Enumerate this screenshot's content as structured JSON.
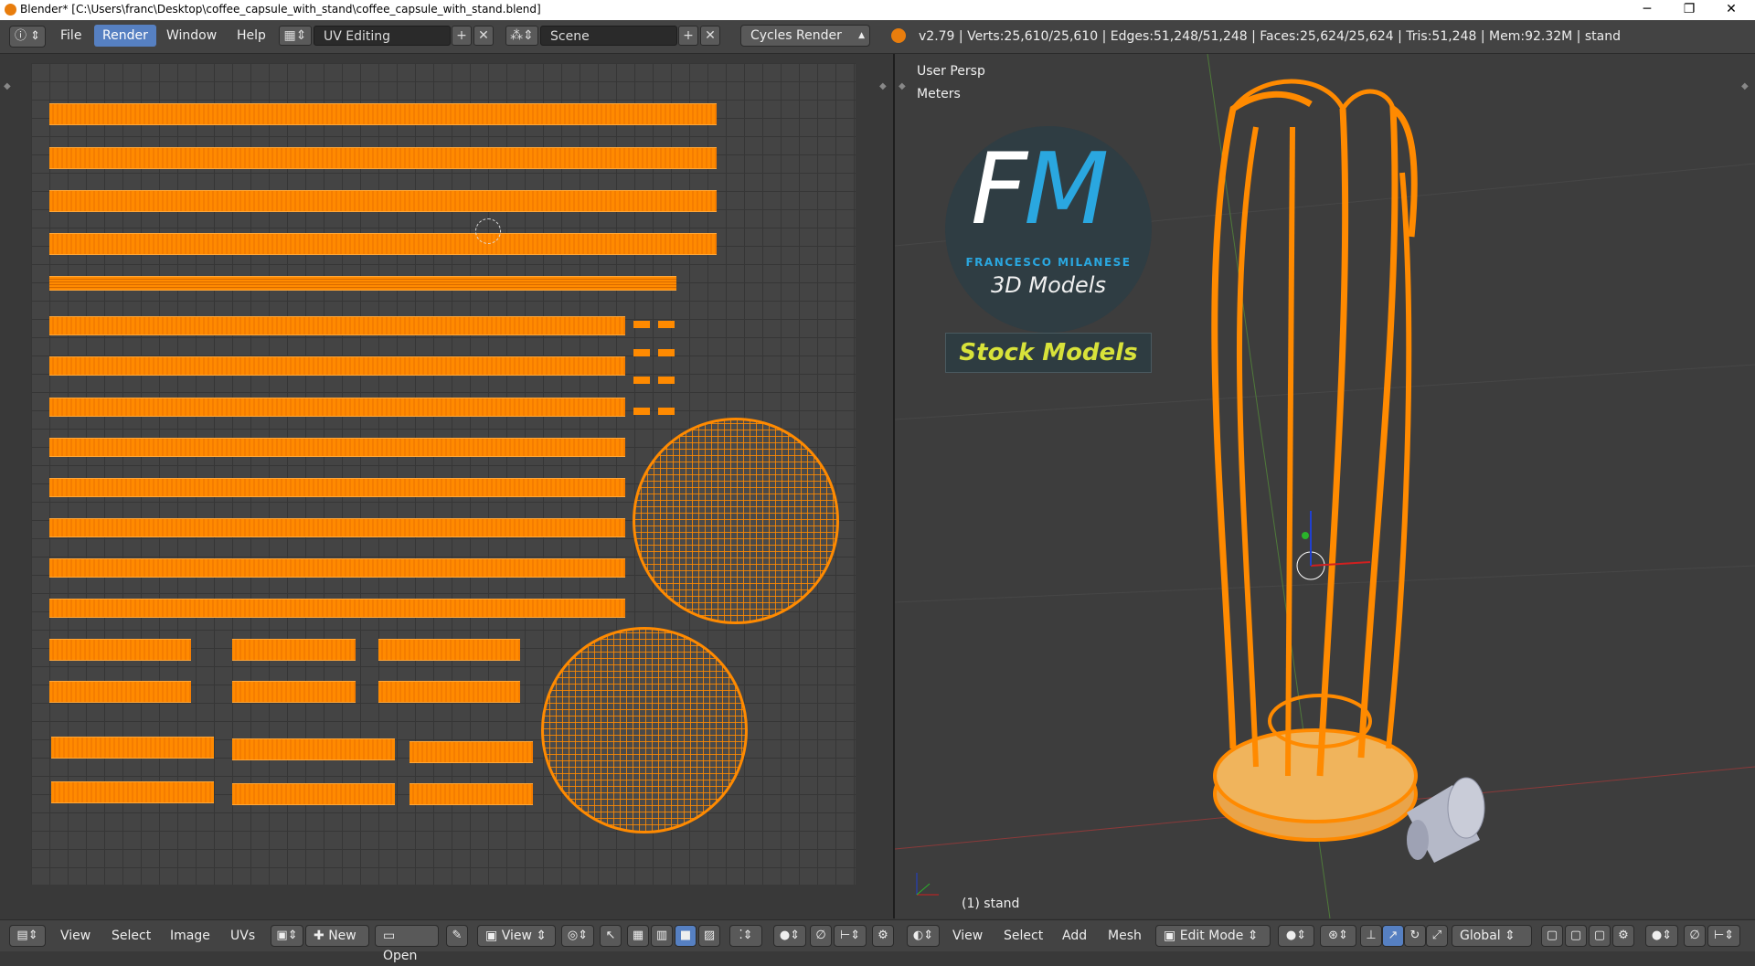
{
  "window": {
    "title": "Blender* [C:\\Users\\franc\\Desktop\\coffee_capsule_with_stand\\coffee_capsule_with_stand.blend]",
    "minimize": "─",
    "restore": "❐",
    "close": "✕"
  },
  "topbar": {
    "menus": [
      "File",
      "Render",
      "Window",
      "Help"
    ],
    "active_menu": "Render",
    "screen_layout": "UV Editing",
    "scene": "Scene",
    "render_engine": "Cycles Render",
    "stats": "v2.79 | Verts:25,610/25,610 | Edges:51,248/51,248 | Faces:25,624/25,624 | Tris:51,248 | Mem:92.32M | stand"
  },
  "viewport": {
    "view_name": "User Persp",
    "units": "Meters",
    "object_label": "(1) stand"
  },
  "watermark": {
    "letter_f": "F",
    "letter_m": "M",
    "author": "FRANCESCO MILANESE",
    "tagline": "3D Models",
    "badge": "Stock Models"
  },
  "uv_footer": {
    "menus": [
      "View",
      "Select",
      "Image",
      "UVs"
    ],
    "new_label": "New",
    "open_label": "Open",
    "view_label": "View"
  },
  "viewport_footer": {
    "menus": [
      "View",
      "Select",
      "Add",
      "Mesh"
    ],
    "mode": "Edit Mode",
    "orientation": "Global"
  },
  "colors": {
    "accent": "#5680c2",
    "mesh_orange": "#ff8a00",
    "background": "#393939"
  }
}
